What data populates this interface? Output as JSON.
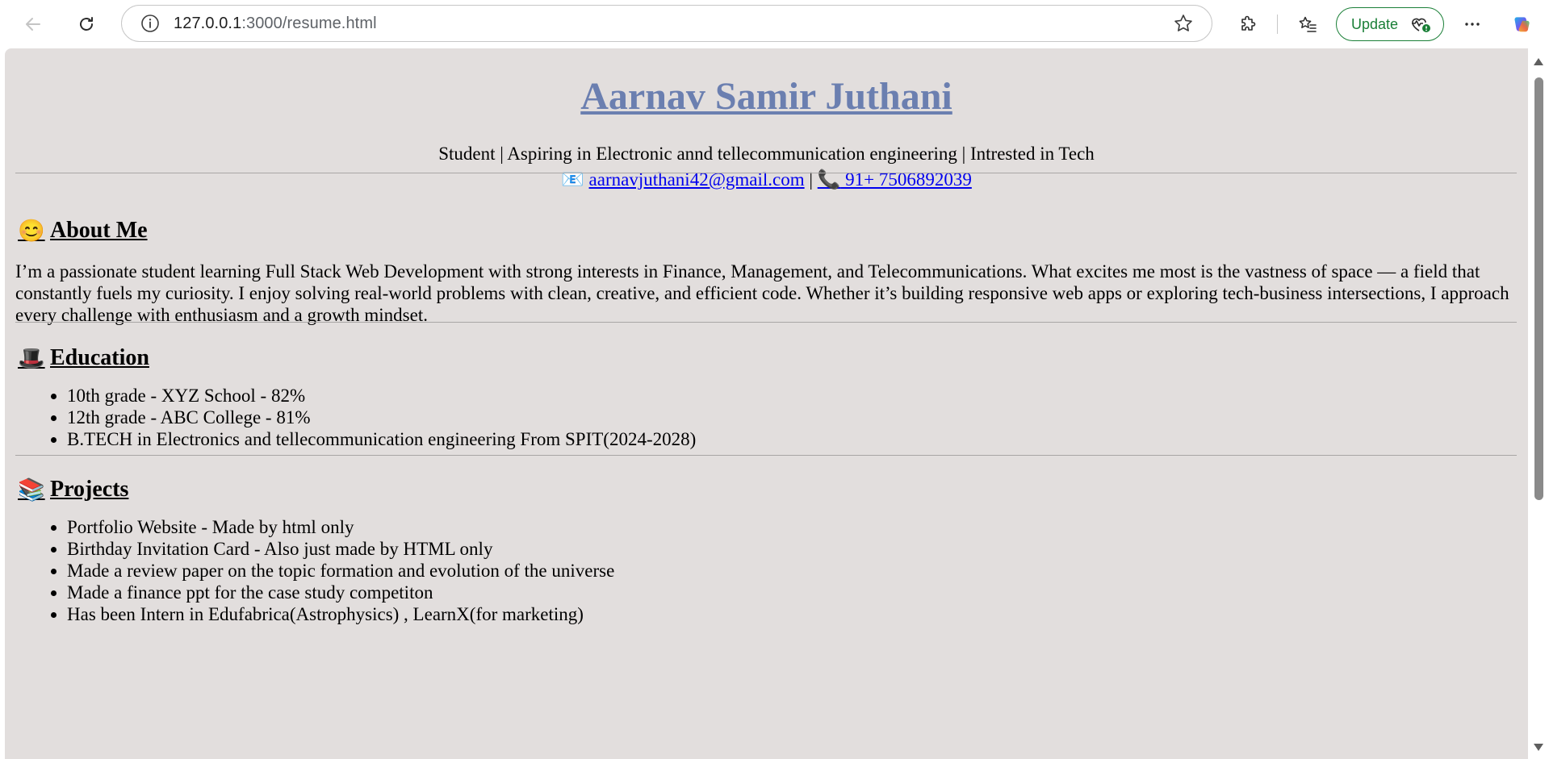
{
  "browser": {
    "url_host": "127.0.0.1",
    "url_path": ":3000/resume.html",
    "update_label": "Update"
  },
  "resume": {
    "name": "Aarnav Samir Juthani",
    "tagline": "Student | Aspiring in Electronic annd tellecommunication engineering | Intrested in Tech",
    "email_emoji": "📧",
    "email": "aarnavjuthani42@gmail.com",
    "separator": "|",
    "phone_emoji": "📞",
    "phone": " 91+ 7506892039",
    "about": {
      "emoji": "😊",
      "title": "About Me",
      "text": "I’m a passionate student learning Full Stack Web Development with strong interests in Finance, Management, and Telecommunications. What excites me most is the vastness of space — a field that constantly fuels my curiosity. I enjoy solving real-world problems with clean, creative, and efficient code. Whether it’s building responsive web apps or exploring tech-business intersections, I approach every challenge with enthusiasm and a growth mindset."
    },
    "education": {
      "emoji": "🎩",
      "title": "Education",
      "items": [
        "10th grade - XYZ School - 82%",
        "12th grade - ABC College - 81%",
        "B.TECH in Electronics and tellecommunication engineering From SPIT(2024-2028)"
      ]
    },
    "projects": {
      "emoji": "📚",
      "title": "Projects",
      "items": [
        "Portfolio Website - Made by html only",
        "Birthday Invitation Card - Also just made by HTML only",
        "Made a review paper on the topic formation and evolution of the universe",
        "Made a finance ppt for the case study competiton",
        "Has been Intern in Edufabrica(Astrophysics) , LearnX(for marketing)"
      ]
    }
  }
}
